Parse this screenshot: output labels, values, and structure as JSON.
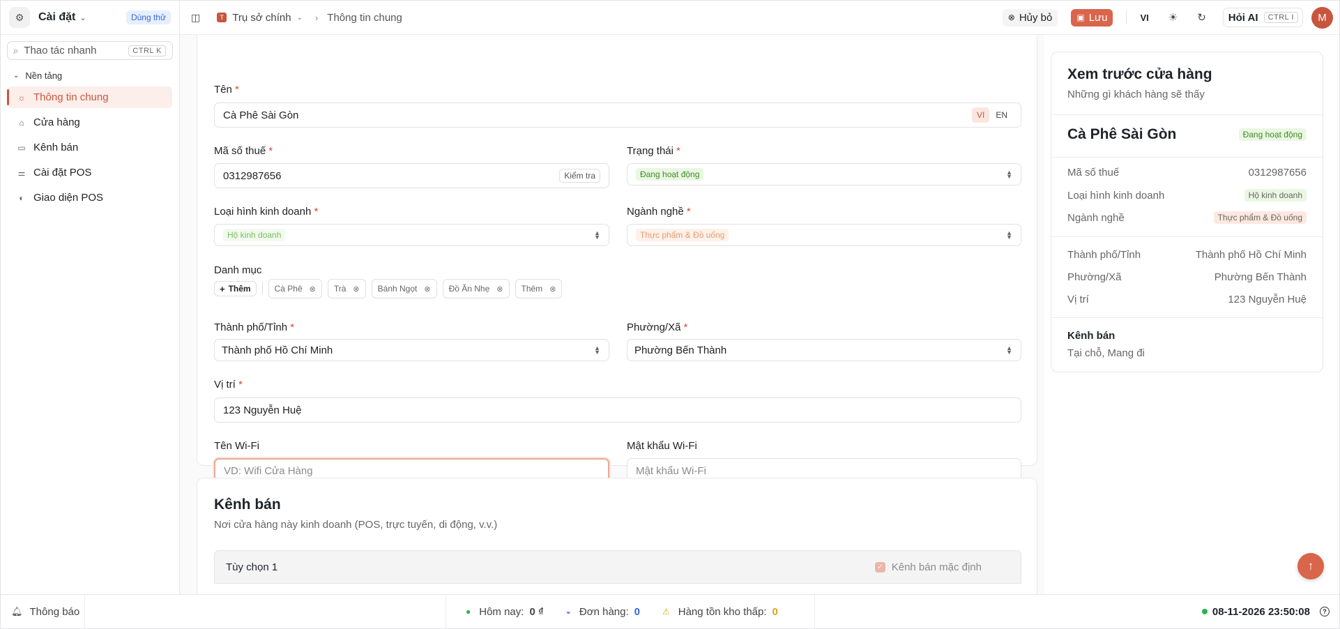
{
  "sidebar": {
    "title": "Cài đặt",
    "trial_badge": "Dùng thử",
    "search": {
      "placeholder": "Thao tác nhanh",
      "shortcut": "CTRL K"
    },
    "group_label": "Nền tảng",
    "items": [
      {
        "label": "Thông tin chung",
        "icon": "sun-icon",
        "active": true
      },
      {
        "label": "Cửa hàng",
        "icon": "store-icon",
        "active": false
      },
      {
        "label": "Kênh bán",
        "icon": "monitor-icon",
        "active": false
      },
      {
        "label": "Cài đặt POS",
        "icon": "sliders-icon",
        "active": false
      },
      {
        "label": "Giao diện POS",
        "icon": "palette-icon",
        "active": false
      }
    ]
  },
  "topbar": {
    "location_initial": "T",
    "location": "Trụ sở chính",
    "breadcrumb": "Thông tin chung",
    "cancel_label": "Hủy bỏ",
    "save_label": "Lưu",
    "lang": "VI",
    "ai_label": "Hỏi AI",
    "ai_shortcut": "CTRL I",
    "avatar_initial": "M"
  },
  "form": {
    "name": {
      "label": "Tên",
      "value": "Cà Phê Sài Gòn",
      "lang_vi": "VI",
      "lang_en": "EN"
    },
    "tax": {
      "label": "Mã số thuế",
      "value": "0312987656",
      "check_label": "Kiểm tra"
    },
    "status": {
      "label": "Trạng thái",
      "value": "Đang hoạt động"
    },
    "business_type": {
      "label": "Loại hình kinh doanh",
      "value": "Hộ kinh doanh"
    },
    "industry": {
      "label": "Ngành nghề",
      "value": "Thực phẩm & Đồ uống"
    },
    "categories": {
      "label": "Danh mục",
      "add_label": "Thêm",
      "tags": [
        "Cà Phê",
        "Trà",
        "Bánh Ngọt",
        "Đồ Ăn Nhẹ",
        "Thêm"
      ]
    },
    "city": {
      "label": "Thành phố/Tỉnh",
      "value": "Thành phố Hồ Chí Minh"
    },
    "ward": {
      "label": "Phường/Xã",
      "value": "Phường Bến Thành"
    },
    "location": {
      "label": "Vị trí",
      "value": "123 Nguyễn Huệ"
    },
    "wifi_name": {
      "label": "Tên Wi-Fi",
      "placeholder": "VD: Wifi Cửa Hàng"
    },
    "wifi_password": {
      "label": "Mật khẩu Wi-Fi",
      "placeholder": "Mật khẩu Wi-Fi"
    },
    "required_mark": "*"
  },
  "channels": {
    "title": "Kênh bán",
    "subtitle": "Nơi cửa hàng này kinh doanh (POS, trực tuyến, di động, v.v.)",
    "option_label": "Tùy chọn 1",
    "default_label": "Kênh bán mặc định"
  },
  "preview": {
    "title": "Xem trước cửa hàng",
    "subtitle": "Những gì khách hàng sẽ thấy",
    "store_name": "Cà Phê Sài Gòn",
    "status": "Đang hoạt động",
    "rows1": [
      {
        "k": "Mã số thuế",
        "v": "0312987656"
      },
      {
        "k": "Loại hình kinh doanh",
        "v": "Hộ kinh doanh"
      },
      {
        "k": "Ngành nghề",
        "v": "Thực phẩm & Đồ uống"
      }
    ],
    "rows2": [
      {
        "k": "Thành phố/Tỉnh",
        "v": "Thành phố Hồ Chí Minh"
      },
      {
        "k": "Phường/Xã",
        "v": "Phường Bến Thành"
      },
      {
        "k": "Vị trí",
        "v": "123 Nguyễn Huệ"
      }
    ],
    "channels_title": "Kênh bán",
    "channels_value": "Tại chỗ, Mang đi"
  },
  "footer": {
    "notifications": "Thông báo",
    "today_label": "Hôm nay:",
    "today_value": "0 ₫",
    "orders_label": "Đơn hàng:",
    "orders_value": "0",
    "low_stock_label": "Hàng tồn kho thấp:",
    "low_stock_value": "0",
    "datetime": "08-11-2026 23:50:08",
    "help": "?"
  },
  "colors": {
    "accent": "#d9654b",
    "active_bg": "#fceeea",
    "success": "#3f8a26"
  }
}
